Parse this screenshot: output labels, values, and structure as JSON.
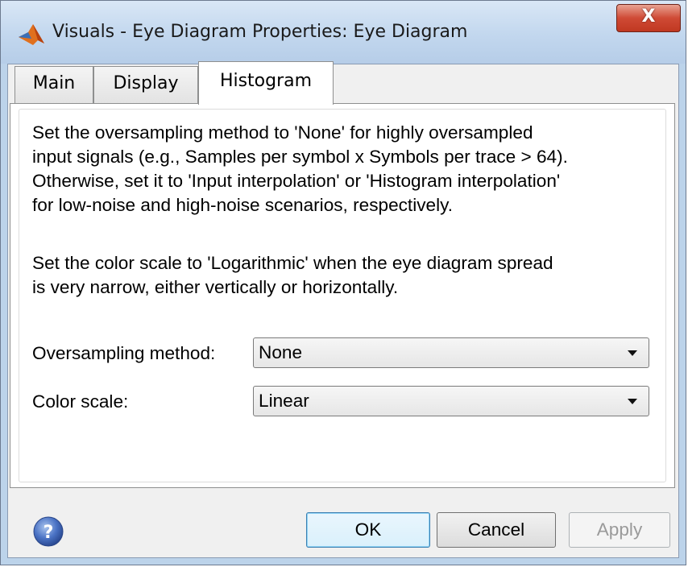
{
  "window": {
    "title": "Visuals - Eye Diagram Properties: Eye Diagram",
    "close_glyph": "X",
    "app_icon": "matlab-icon"
  },
  "tabs": [
    {
      "label": "Main",
      "active": false
    },
    {
      "label": "Display",
      "active": false
    },
    {
      "label": "Histogram",
      "active": true
    }
  ],
  "panel": {
    "paragraph1": "Set the oversampling method to 'None' for highly oversampled\ninput signals (e.g., Samples per symbol x Symbols per trace > 64).\nOtherwise, set it to 'Input interpolation' or 'Histogram interpolation'\nfor low-noise and high-noise scenarios, respectively.",
    "paragraph2": "Set the color scale to 'Logarithmic' when the eye diagram spread\nis very narrow, either vertically or horizontally.",
    "oversampling_label": "Oversampling method:",
    "oversampling_value": "None",
    "color_scale_label": "Color scale:",
    "color_scale_value": "Linear"
  },
  "buttons": {
    "help_icon": "help-icon",
    "ok": "OK",
    "cancel": "Cancel",
    "apply": "Apply",
    "apply_enabled": false
  }
}
